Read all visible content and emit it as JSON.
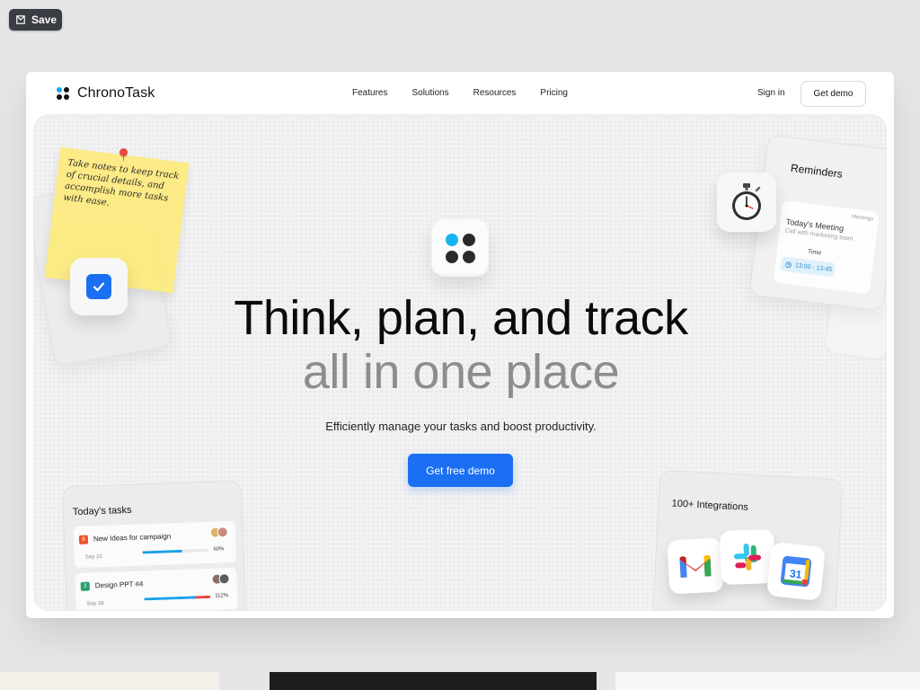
{
  "toolbar": {
    "save_label": "Save"
  },
  "brand": {
    "name": "ChronoTask"
  },
  "nav": {
    "links": [
      "Features",
      "Solutions",
      "Resources",
      "Pricing"
    ],
    "signin": "Sign in",
    "demo": "Get demo"
  },
  "hero": {
    "headline": "Think, plan, and track",
    "subheadline": "all in one place",
    "tagline": "Efficiently manage your tasks and boost productivity.",
    "cta": "Get free demo"
  },
  "sticky_note": {
    "text": "Take notes to keep track of crucial details, and accomplish more tasks with ease."
  },
  "reminders": {
    "title": "Reminders",
    "tag": "Meetings",
    "meeting": "Today's Meeting",
    "subtitle": "Call with marketing team",
    "time_label": "Time",
    "time": "13:00 - 13:45"
  },
  "tasks": {
    "title": "Today's tasks",
    "items": [
      {
        "badge": "8",
        "badge_color": "#f0542a",
        "name": "New Ideas for campaign",
        "date": "Sep 10",
        "percent_label": "60%",
        "progress": 0.6,
        "bar_color": "#1aa1e8"
      },
      {
        "badge": "3",
        "badge_color": "#2aa26b",
        "name": "Design PPT #4",
        "date": "Sep 18",
        "percent_label": "112%",
        "progress": 1.0,
        "bar_color": "#1aa1e8"
      }
    ]
  },
  "integrations": {
    "title": "100+ Integrations"
  },
  "colors": {
    "accent": "#1a6ff2",
    "brand_dot": "#18a6e8"
  }
}
